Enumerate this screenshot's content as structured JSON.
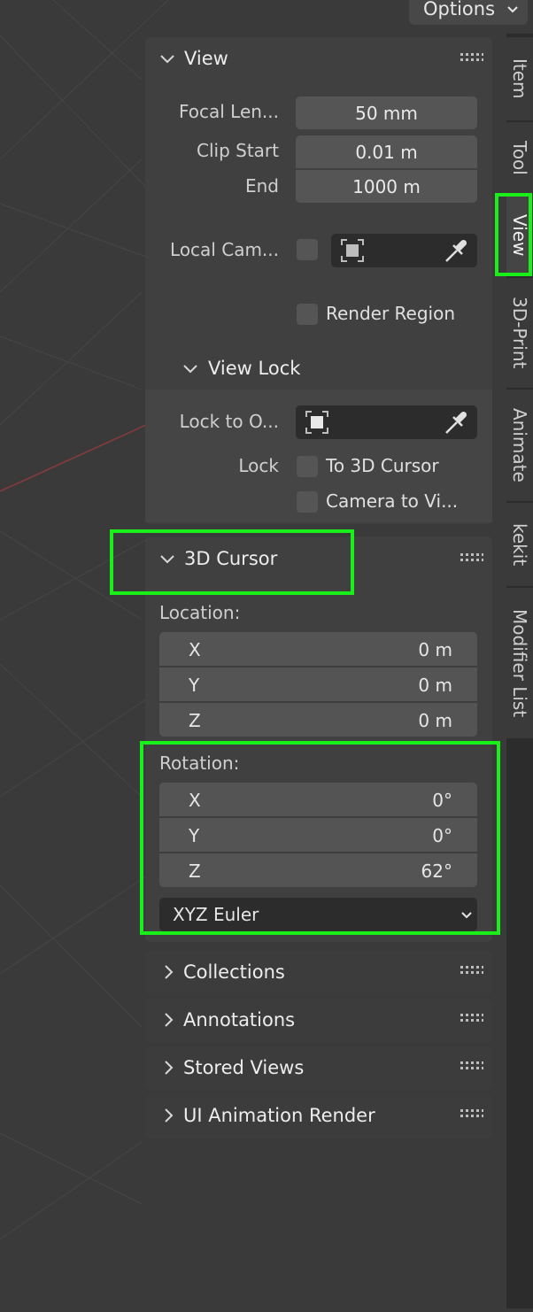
{
  "header": {
    "options_label": "Options"
  },
  "view_panel": {
    "title": "View",
    "focal_length": {
      "label": "Focal Len...",
      "value": "50 mm"
    },
    "clip_start": {
      "label": "Clip Start",
      "value": "0.01 m"
    },
    "clip_end": {
      "label": "End",
      "value": "1000 m"
    },
    "local_camera": {
      "label": "Local Cam..."
    },
    "render_region": {
      "label": "Render Region"
    },
    "view_lock": {
      "title": "View Lock",
      "lock_to_object": {
        "label": "Lock to O..."
      },
      "lock_label": "Lock",
      "to_3d_cursor": "To 3D Cursor",
      "camera_to_view": "Camera to Vi..."
    }
  },
  "cursor_panel": {
    "title": "3D Cursor",
    "location": {
      "label": "Location:",
      "rows": [
        {
          "axis": "X",
          "value": "0 m"
        },
        {
          "axis": "Y",
          "value": "0 m"
        },
        {
          "axis": "Z",
          "value": "0 m"
        }
      ]
    },
    "rotation": {
      "label": "Rotation:",
      "rows": [
        {
          "axis": "X",
          "value": "0°"
        },
        {
          "axis": "Y",
          "value": "0°"
        },
        {
          "axis": "Z",
          "value": "62°"
        }
      ],
      "mode": "XYZ Euler"
    }
  },
  "collapsed_panels": [
    "Collections",
    "Annotations",
    "Stored Views",
    "UI Animation Render"
  ],
  "tabs": [
    "Item",
    "Tool",
    "View",
    "3D-Print",
    "Animate",
    "kekit",
    "Modifier List"
  ],
  "colors": {
    "highlight": "#19f019",
    "panel": "#404040",
    "field": "#555555"
  }
}
